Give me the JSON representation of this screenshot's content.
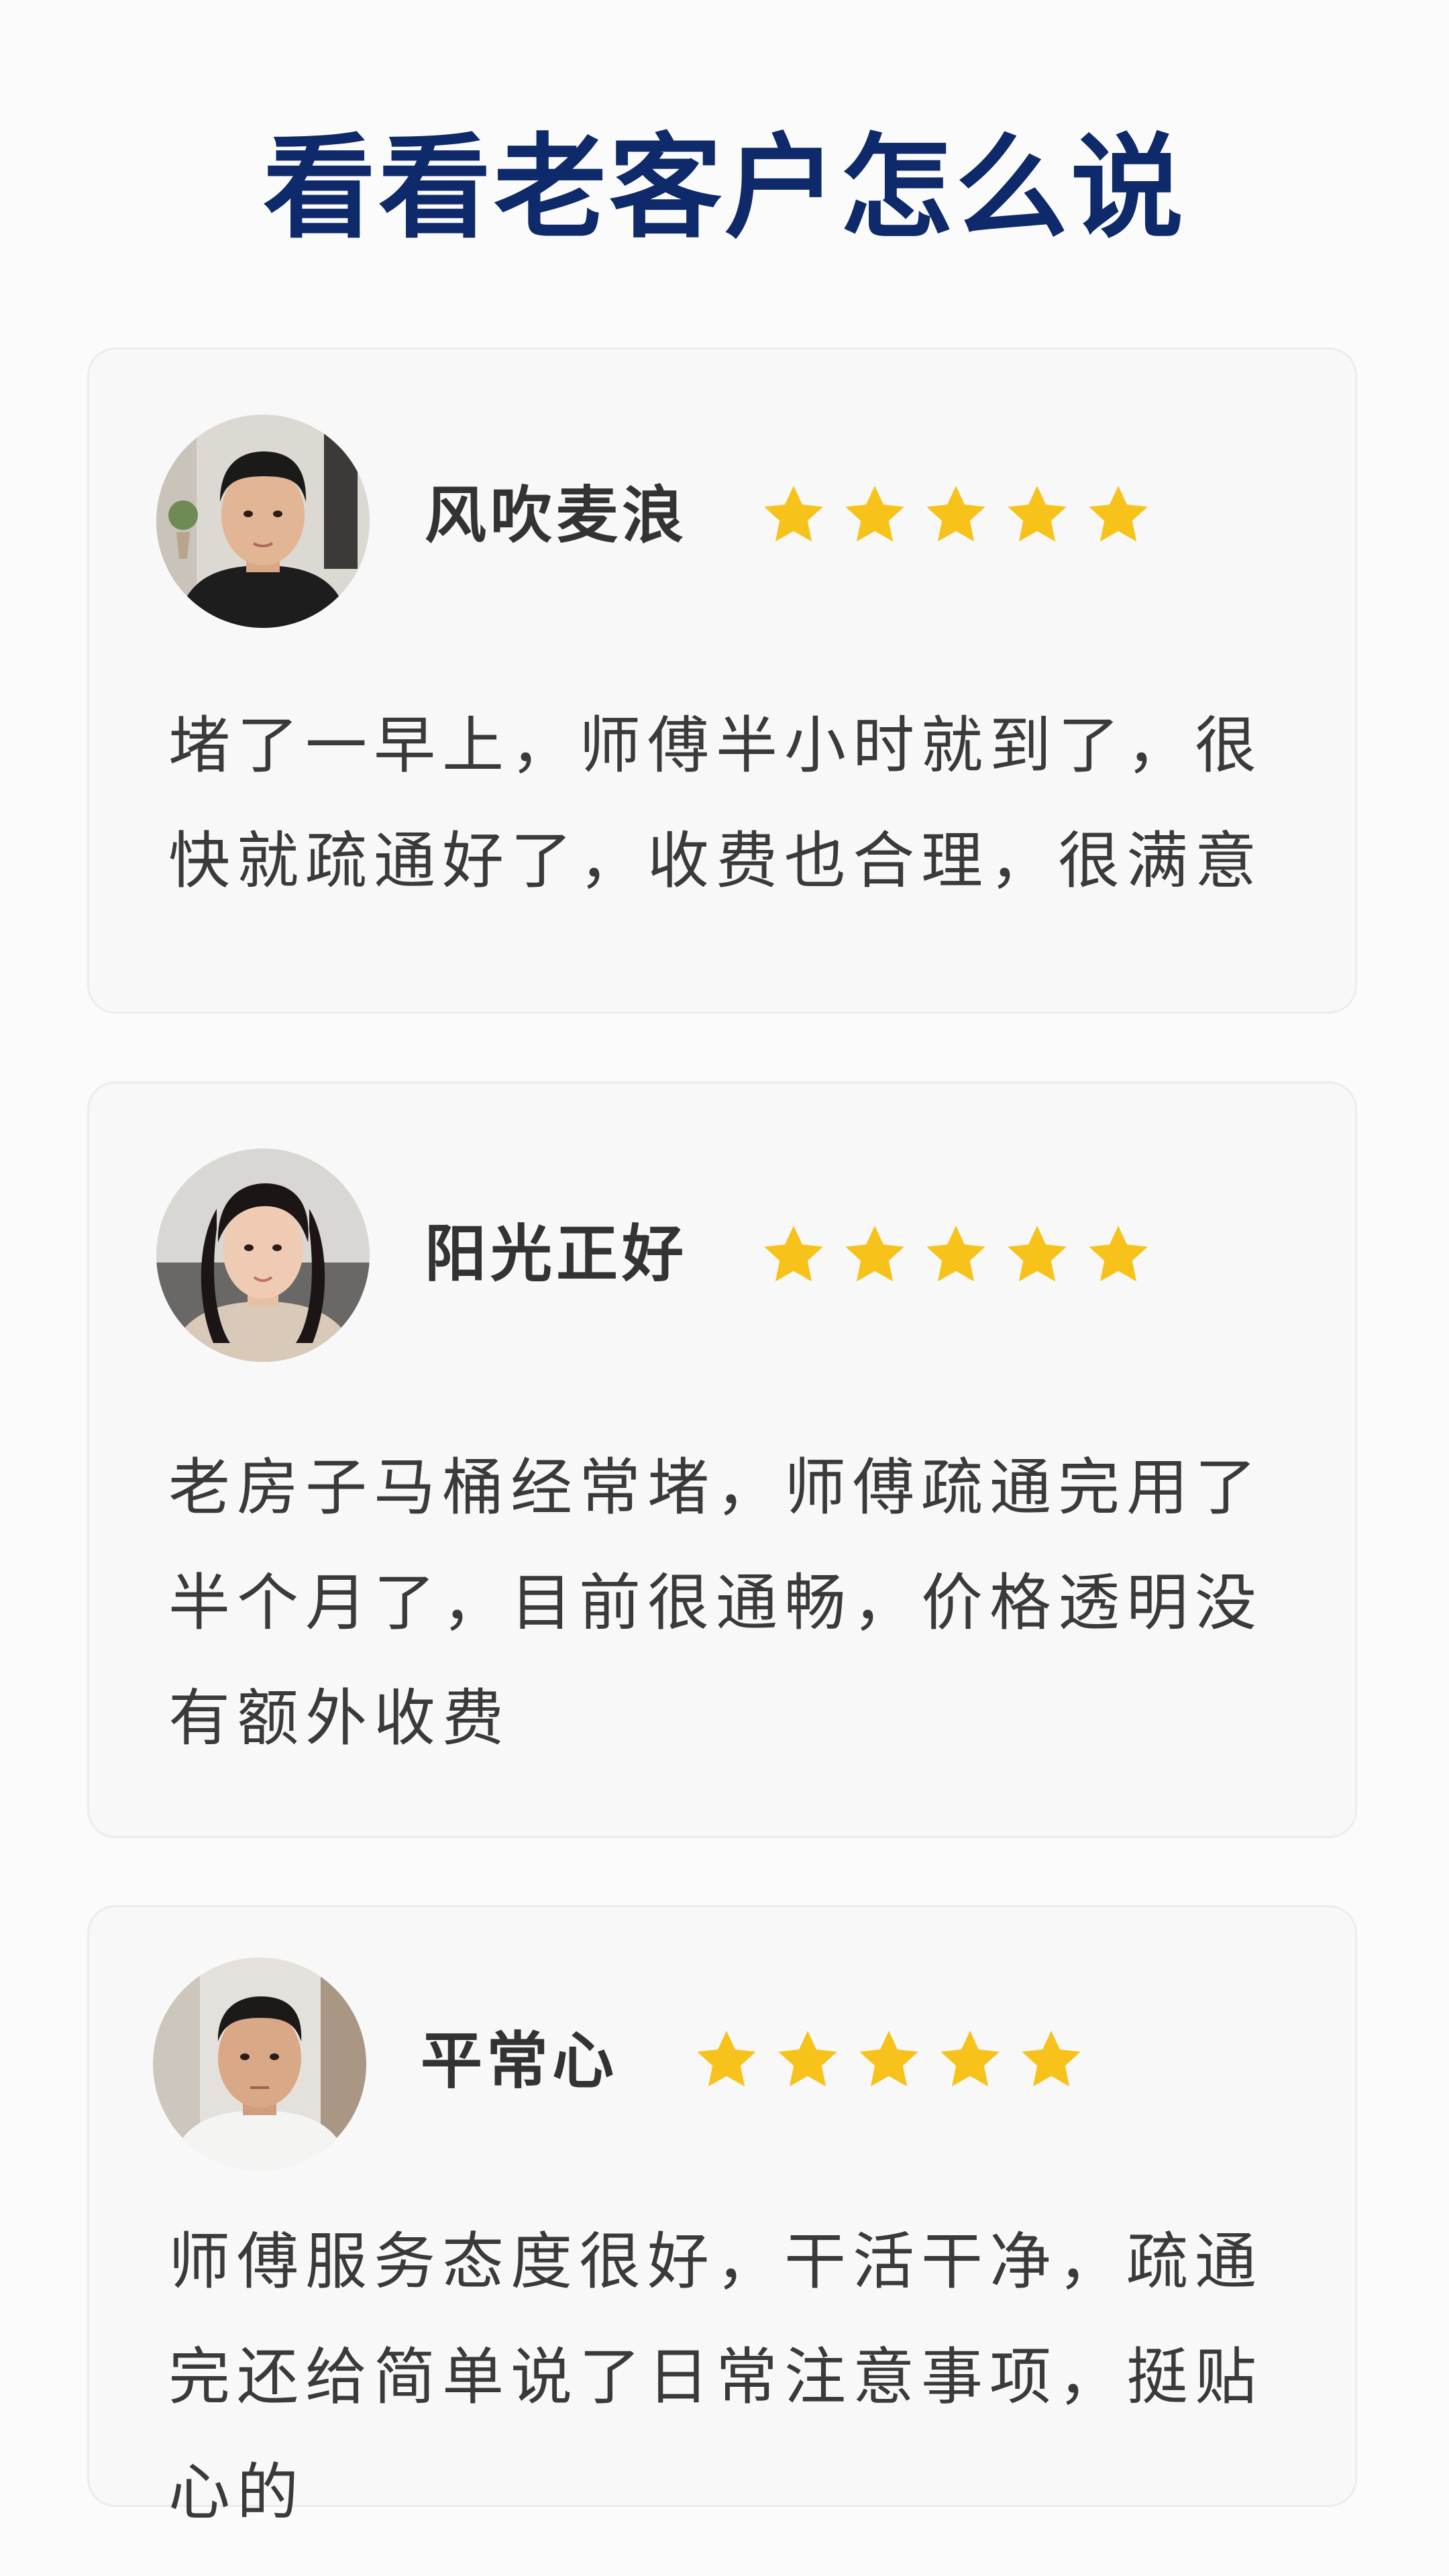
{
  "header": {
    "title": "看看老客户怎么说"
  },
  "colors": {
    "title": "#0f2a6b",
    "star": "#f7c21a",
    "card_bg": "#f8f8f8",
    "card_border": "#ececec",
    "text": "#3a3a3a"
  },
  "reviews": [
    {
      "name": "风吹麦浪",
      "rating": 5,
      "avatar_icon": "male-avatar",
      "text": "堵了一早上，师傅半小时就到了，很快就疏通好了，收费也合理，很满意"
    },
    {
      "name": "阳光正好",
      "rating": 5,
      "avatar_icon": "female-avatar",
      "text": "老房子马桶经常堵，师傅疏通完用了半个月了，目前很通畅，价格透明没有额外收费"
    },
    {
      "name": "平常心",
      "rating": 5,
      "avatar_icon": "male-avatar",
      "text": "师傅服务态度很好，干活干净，疏通完还给简单说了日常注意事项，挺贴心的"
    }
  ]
}
